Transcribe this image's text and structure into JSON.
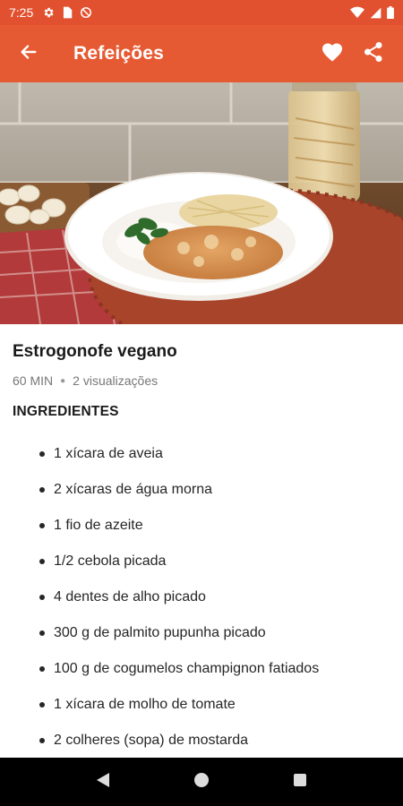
{
  "status_bar": {
    "time": "7:25",
    "left_icons": [
      "gear-icon",
      "sim-card-icon",
      "no-disturb-icon"
    ],
    "right_icons": [
      "wifi-icon",
      "signal-icon",
      "battery-icon"
    ],
    "background": "#e2512f"
  },
  "app_bar": {
    "title": "Refeições",
    "back_icon": "arrow-back-icon",
    "actions": [
      "heart-icon",
      "share-icon"
    ],
    "background": "#e65a33"
  },
  "recipe": {
    "title": "Estrogonofe vegano",
    "time": "60 MIN",
    "views": "2 visualizações",
    "ingredients_heading": "INGREDIENTES",
    "ingredients": [
      "1 xícara de aveia",
      "2 xícaras de água morna",
      "1 fio de azeite",
      "1/2 cebola picada",
      "4 dentes de alho picado",
      "300 g de palmito pupunha picado",
      "100 g de cogumelos champignon fatiados",
      "1 xícara de molho de tomate",
      "2 colheres (sopa) de mostarda"
    ]
  },
  "nav_bar": {
    "buttons": [
      "back-triangle-icon",
      "home-circle-icon",
      "recents-square-icon"
    ]
  }
}
